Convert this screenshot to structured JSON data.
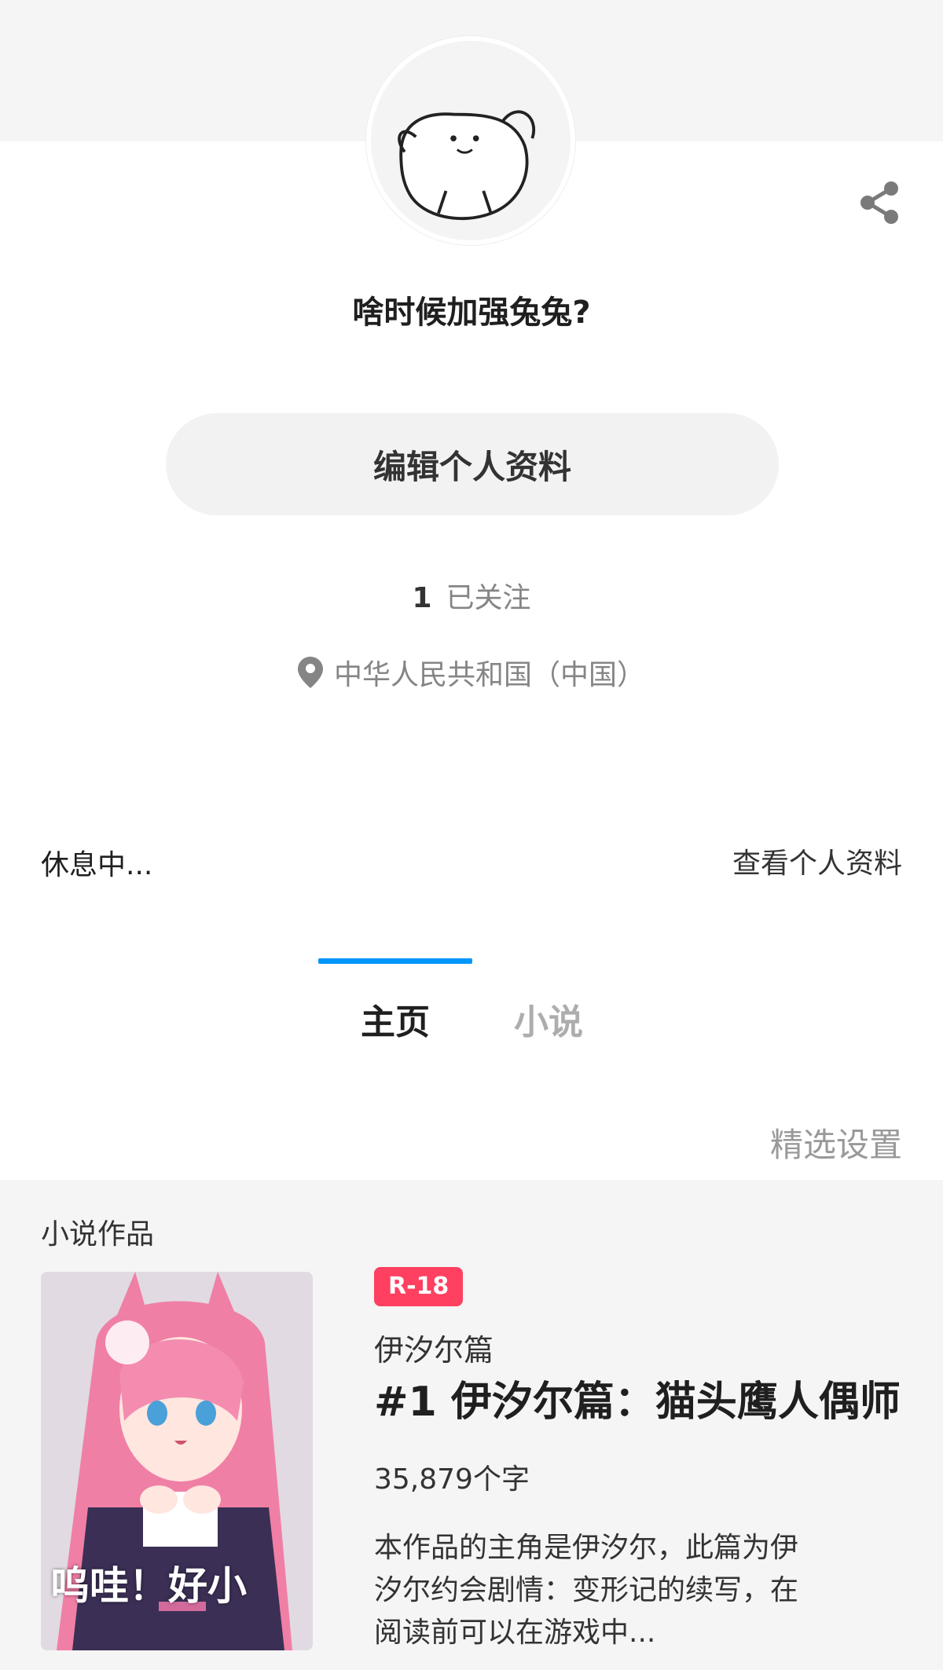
{
  "profile": {
    "avatar_label": "avatar",
    "username": "啥时候加强兔兔?",
    "edit_button_label": "编辑个人资料",
    "following_count": "1",
    "following_label": "已关注",
    "location": "中华人民共和国（中国）",
    "status": "休息中...",
    "view_profile_label": "查看个人资料"
  },
  "tabs": [
    {
      "label": "主页",
      "active": true
    },
    {
      "label": "小说",
      "active": false
    }
  ],
  "curation_label": "精选设置",
  "works": {
    "heading": "小说作品",
    "items": [
      {
        "badge": "R-18",
        "series": "伊汐尔篇",
        "title": "#1 伊汐尔篇：猫头鹰人偶师",
        "word_count": "35,879个字",
        "description": "本作品的主角是伊汐尔，此篇为伊汐尔约会剧情：变形记的续写，在阅读前可以在游戏中...",
        "thumbnail_caption": "呜哇！好小"
      }
    ]
  },
  "colors": {
    "accent": "#0096fa",
    "badge": "#ff4060",
    "muted_text": "#858585",
    "section_bg": "#f5f5f5"
  },
  "icons": {
    "share": "share-icon",
    "location": "location-pin-icon"
  }
}
